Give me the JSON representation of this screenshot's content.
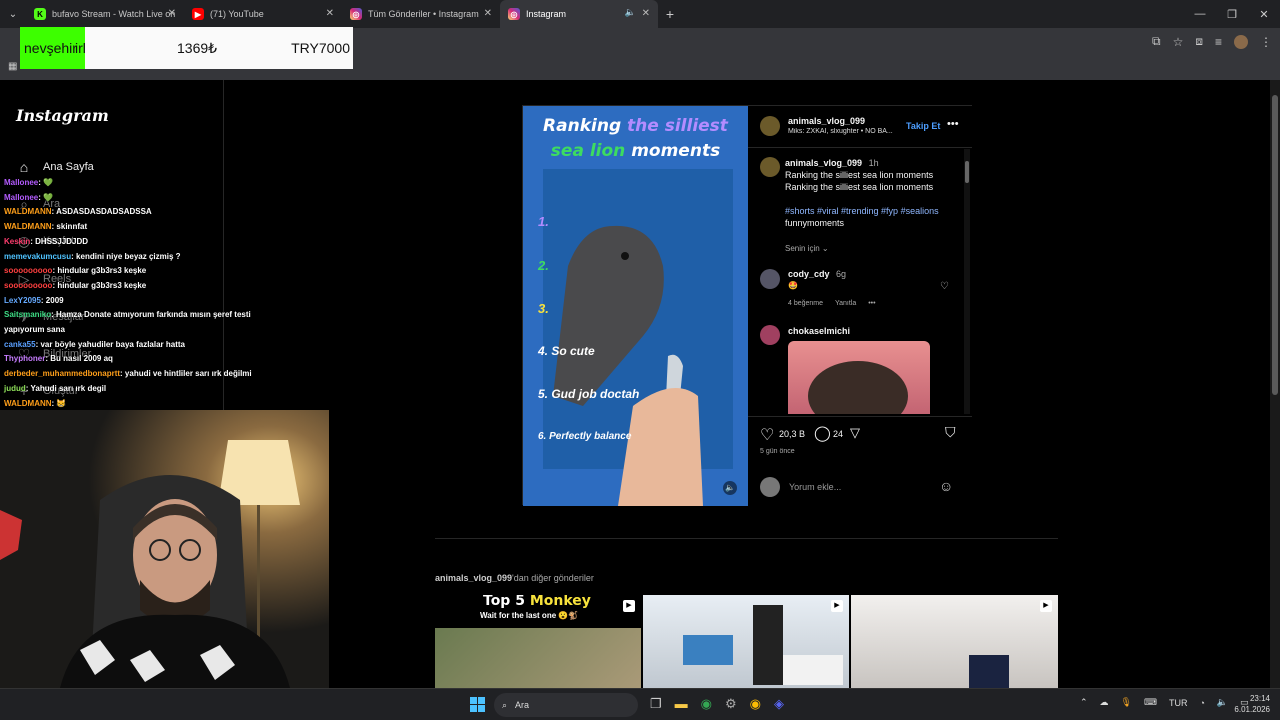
{
  "browser": {
    "tabs": [
      {
        "title": "bufavo Stream - Watch Live on",
        "icon": "kick-icon",
        "color": "#53fc18"
      },
      {
        "title": "(71) YouTube",
        "icon": "youtube-icon",
        "color": "#ff0000"
      },
      {
        "title": "Tüm Gönderiler • Instagram",
        "icon": "instagram-icon",
        "color": "#d62976"
      },
      {
        "title": "Instagram",
        "icon": "instagram-icon",
        "color": "#d62976",
        "active": true
      }
    ]
  },
  "ticker": {
    "city": "nevşehir",
    "rl": "irl",
    "price": "1369₺",
    "try": "TRY7000"
  },
  "instagram": {
    "logo": "Instagram",
    "nav": [
      {
        "label": "Ana Sayfa",
        "icon": "home-icon"
      },
      {
        "label": "Ara",
        "icon": "search-icon"
      },
      {
        "label": "Keşfet",
        "icon": "explore-icon"
      },
      {
        "label": "Reels",
        "icon": "reels-icon"
      },
      {
        "label": "Mesajlar",
        "icon": "messages-icon"
      },
      {
        "label": "Bildirimler",
        "icon": "heart-icon"
      },
      {
        "label": "Oluştur",
        "icon": "create-icon"
      }
    ],
    "post": {
      "author": "animals_vlog_099",
      "audio": "Miks: ZXKAI, slxughter • NO BA...",
      "follow": "Takip Et",
      "caption_user": "animals_vlog_099",
      "caption_time": "1h",
      "caption_line1": "Ranking the silliest sea lion moments",
      "caption_line2": "Ranking the silliest sea lion moments",
      "hashtags": "#shorts #viral #trending #fyp #sealions",
      "hashtags2": "funnymoments",
      "for_you": "Senin için",
      "comment1_user": "cody_cdy",
      "comment1_time": "6g",
      "comment1_likes": "4 beğenme",
      "comment1_reply": "Yanıtla",
      "comment2_user": "chokaselmichi",
      "likes": "20,3 B",
      "comments": "24",
      "date": "5 gün önce",
      "add_comment": "Yorum ekle...",
      "media": {
        "title1": "Ranking",
        "title1b": "the silliest",
        "title2a": "sea lion",
        "title2b": "moments",
        "items": [
          "1.",
          "2.",
          "3.",
          "4. So cute",
          "5. Gud job doctah",
          "6. Perfectly balance"
        ]
      }
    },
    "more_label_user": "animals_vlog_099",
    "more_label_rest": "'dan diğer gönderiler",
    "thumb1_title_a": "Top 5",
    "thumb1_title_b": "Monkey",
    "thumb1_sub": "Wait for the last one 😮🐒"
  },
  "chat": [
    {
      "user": "Mallonee",
      "msg": ": 💚",
      "color": "#b45cff"
    },
    {
      "user": "Mallonee",
      "msg": ": 💚",
      "color": "#b45cff"
    },
    {
      "user": "WALDMANN",
      "msg": ": ASDASDASDADSADSSA",
      "color": "#ff9f1a"
    },
    {
      "user": "WALDMANN",
      "msg": ": skinnfat",
      "color": "#ff9f1a"
    },
    {
      "user": "Keskin",
      "msg": ": DHSSJJDJDD",
      "color": "#ff3d6e"
    },
    {
      "user": "memevakumcusu",
      "msg": ": kendini niye beyaz çizmiş ?",
      "color": "#4fc3ff"
    },
    {
      "user": "sooooooooo",
      "msg": ": hindular g3b3rs3 keşke",
      "color": "#ff4040"
    },
    {
      "user": "sooooooooo",
      "msg": ": hindular g3b3rs3 keşke",
      "color": "#ff4040"
    },
    {
      "user": "LexY2095",
      "msg": ": 2009",
      "color": "#66aaff"
    },
    {
      "user": "Saitsmaniko",
      "msg": ": Hamza Donate atmıyorum farkında mısın şeref testi",
      "color": "#3ddc84"
    },
    {
      "user": "",
      "msg": "yapıyorum sana",
      "color": "#fff"
    },
    {
      "user": "canka55",
      "msg": ": var böyle yahudiler baya fazlalar hatta",
      "color": "#5aa0ff"
    },
    {
      "user": "Thyphoner",
      "msg": ": Bu nasıl 2009 aq",
      "color": "#c77dff"
    },
    {
      "user": "derbeder_muhammedbonaprtt",
      "msg": ": yahudi ve hintliler sarı ırk değilmi",
      "color": "#ff9f1a"
    },
    {
      "user": "judud",
      "msg": ": Yahudi sarı ırk degil",
      "color": "#8fe05a"
    },
    {
      "user": "WALDMANN",
      "msg": ": 😸",
      "color": "#ff9f1a"
    }
  ],
  "taskbar": {
    "search": "Ara",
    "lang": "TUR",
    "time": "23:14",
    "date": "6.01.2026"
  }
}
